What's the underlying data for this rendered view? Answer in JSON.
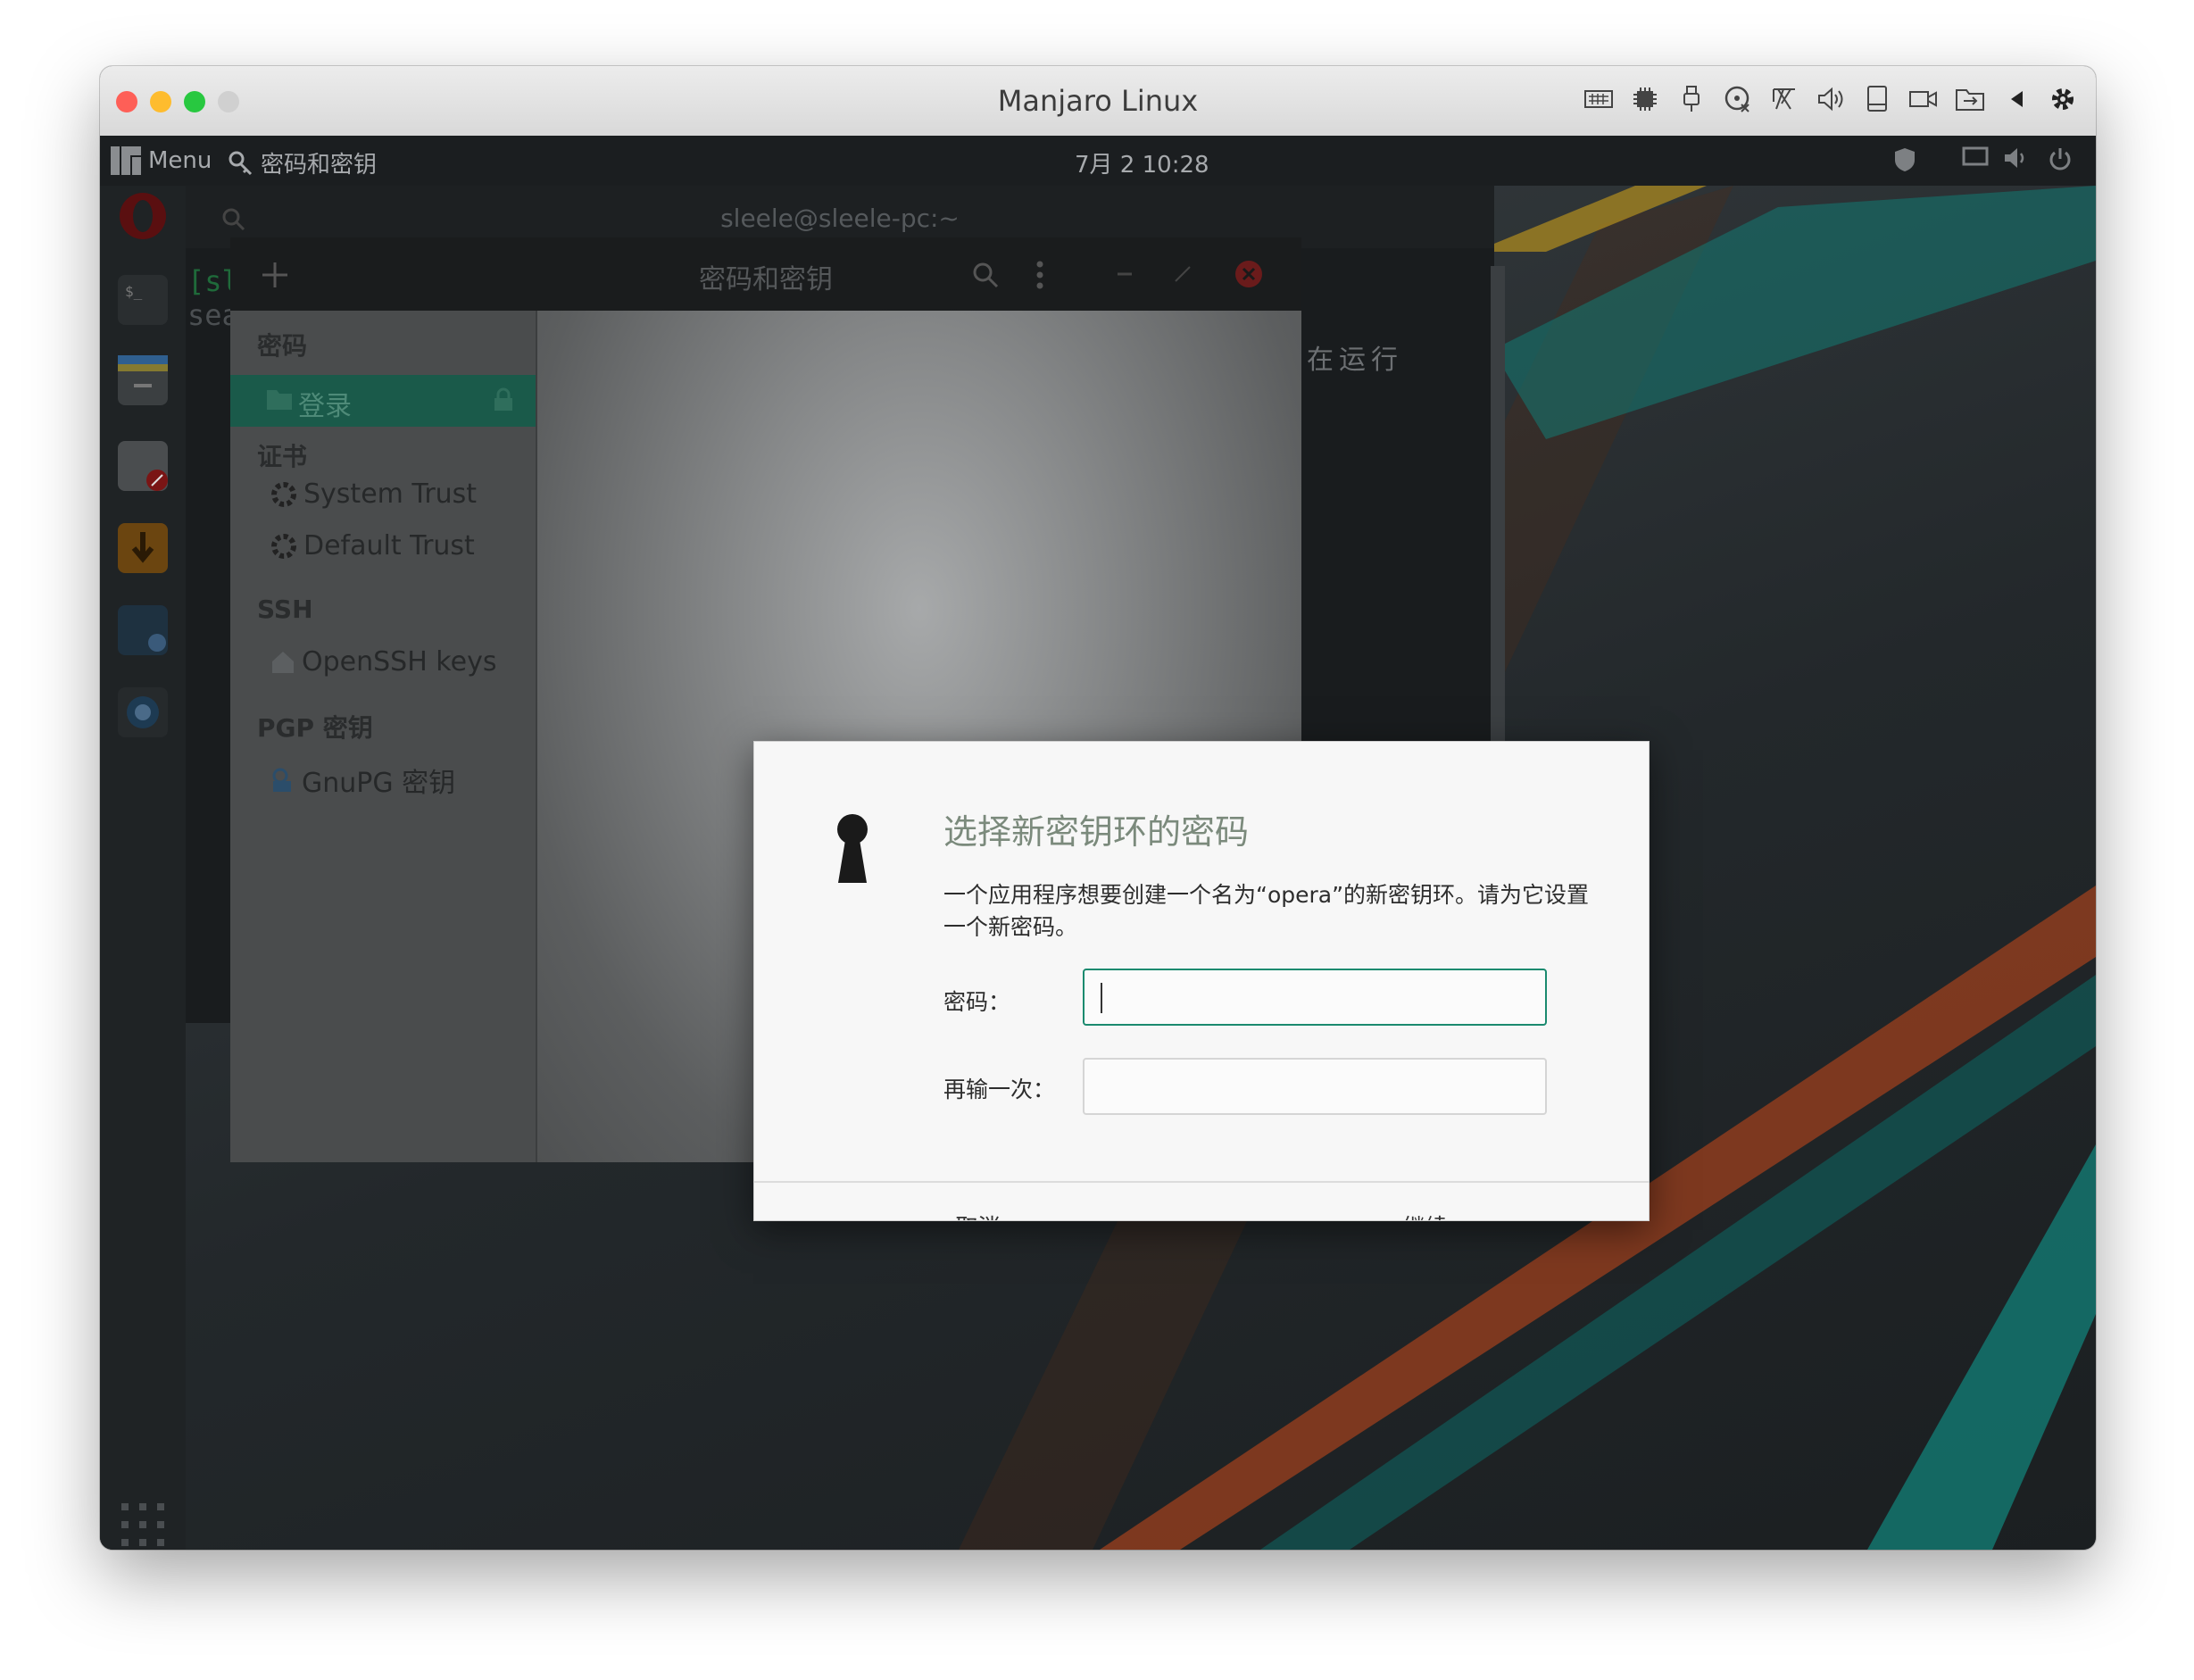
{
  "host": {
    "title": "Manjaro Linux",
    "icons": [
      "keyboard-icon",
      "cpu-icon",
      "usb-icon",
      "optical-drive-icon",
      "network-icon",
      "audio-icon",
      "storage-icon",
      "camera-icon",
      "shared-folder-icon",
      "back-arrow-icon",
      "settings-gear-icon"
    ]
  },
  "topbar": {
    "menu_label": "Menu",
    "app_label": "密码和密钥",
    "clock": "7月 2  10:28"
  },
  "terminal": {
    "title": "sleele@sleele-pc:~",
    "prompt_fragment": "[sl",
    "command_fragment": "sea",
    "status_text": "不在运行"
  },
  "seahorse": {
    "title": "密码和密钥",
    "sidebar": {
      "passwords_heading": "密码",
      "login_item": "登录",
      "certificates_heading": "证书",
      "system_trust": "System Trust",
      "default_trust": "Default Trust",
      "ssh_heading": "SSH",
      "openssh_keys": "OpenSSH keys",
      "pgp_heading": "PGP 密钥",
      "gnupg_keys": "GnuPG 密钥"
    }
  },
  "dialog": {
    "title": "选择新密钥环的密码",
    "description": "一个应用程序想要创建一个名为“opera”的新密钥环。请为它设置一个新密码。",
    "password_label": "密码：",
    "confirm_label": "再输一次：",
    "password_value": "",
    "confirm_value": "",
    "cancel_label": "取消",
    "continue_label": "继续"
  },
  "colors": {
    "accent": "#1b8a6f",
    "dialog_title": "#7b8a7c",
    "wallpaper_teal": "#137a73",
    "wallpaper_orange": "#a5421c",
    "wallpaper_yellow": "#b48f1e"
  }
}
